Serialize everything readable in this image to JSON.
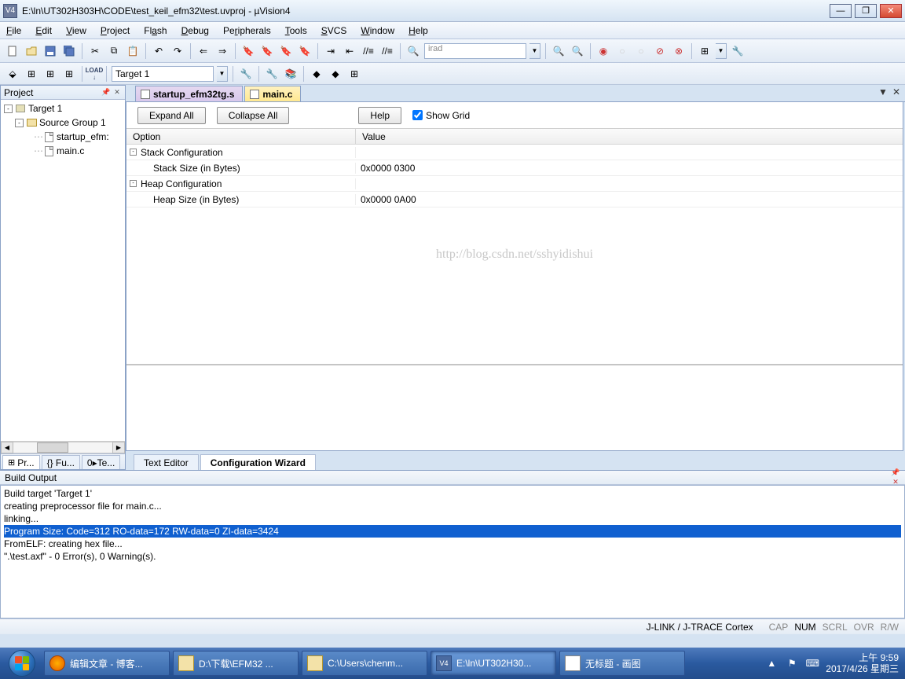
{
  "window": {
    "title": "E:\\ln\\UT302H303H\\CODE\\test_keil_efm32\\test.uvproj - µVision4",
    "app_icon_text": "V4"
  },
  "menu": [
    "File",
    "Edit",
    "View",
    "Project",
    "Flash",
    "Debug",
    "Peripherals",
    "Tools",
    "SVCS",
    "Window",
    "Help"
  ],
  "toolbar1": {
    "search_text": "irad"
  },
  "toolbar2": {
    "target": "Target 1"
  },
  "project_panel": {
    "title": "Project",
    "tree": {
      "root": "Target 1",
      "group": "Source Group 1",
      "files": [
        "startup_efm32tg.s",
        "main.c"
      ],
      "file_display": [
        "startup_efm:",
        "main.c"
      ]
    },
    "tabs": [
      "Pr...",
      "{} Fu...",
      "0▸Te..."
    ]
  },
  "file_tabs": {
    "inactive": "startup_efm32tg.s",
    "active": "main.c"
  },
  "config_wizard": {
    "btn_expand": "Expand All",
    "btn_collapse": "Collapse All",
    "btn_help": "Help",
    "chk_grid": "Show Grid",
    "header_option": "Option",
    "header_value": "Value",
    "rows": [
      {
        "label": "Stack Configuration",
        "value": "",
        "level": 0,
        "toggle": "-"
      },
      {
        "label": "Stack Size (in Bytes)",
        "value": "0x0000 0300",
        "level": 1
      },
      {
        "label": "Heap Configuration",
        "value": "",
        "level": 0,
        "toggle": "-"
      },
      {
        "label": "Heap Size (in Bytes)",
        "value": "0x0000 0A00",
        "level": 1
      }
    ]
  },
  "editor_tabs": {
    "text": "Text Editor",
    "wizard": "Configuration Wizard"
  },
  "watermark": "http://blog.csdn.net/sshyidishui",
  "build": {
    "title": "Build Output",
    "lines": [
      "Build target 'Target 1'",
      "creating preprocessor file for main.c...",
      "linking...",
      "Program Size: Code=312 RO-data=172 RW-data=0 ZI-data=3424",
      "FromELF: creating hex file...",
      "\".\\test.axf\" - 0 Error(s), 0 Warning(s)."
    ],
    "selected_index": 3
  },
  "status": {
    "debugger": "J-LINK / J-TRACE Cortex",
    "indicators": [
      "CAP",
      "NUM",
      "SCRL",
      "OVR",
      "R/W"
    ],
    "active_indicator": 1
  },
  "taskbar": {
    "items": [
      {
        "label": "编辑文章 - 博客...",
        "icon": "firefox"
      },
      {
        "label": "D:\\下载\\EFM32 ...",
        "icon": "folder"
      },
      {
        "label": "C:\\Users\\chenm...",
        "icon": "folder"
      },
      {
        "label": "E:\\ln\\UT302H30...",
        "icon": "uv4",
        "active": true
      },
      {
        "label": "无标题 - 画图",
        "icon": "paint"
      }
    ],
    "clock": {
      "time": "上午 9:59",
      "date": "2017/4/26 星期三"
    }
  }
}
